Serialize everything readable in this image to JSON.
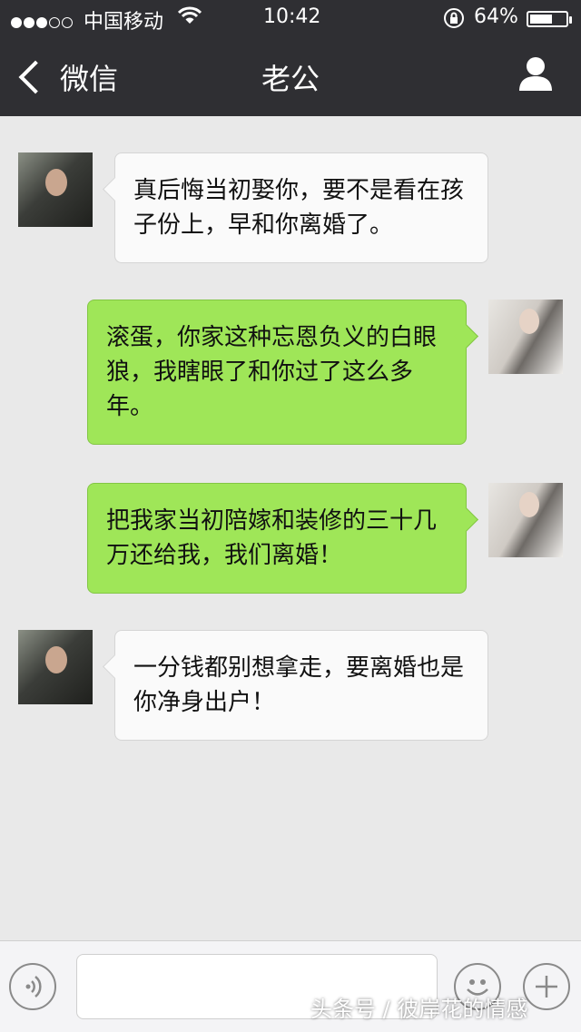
{
  "status_bar": {
    "carrier": "中国移动",
    "time": "10:42",
    "battery_percent": "64%",
    "battery_level": 0.64,
    "signal_bars_filled": 3,
    "signal_bars_total": 5
  },
  "nav": {
    "back_label": "微信",
    "title": "老公",
    "profile_icon": "person-icon"
  },
  "messages": [
    {
      "side": "in",
      "sender": "husband",
      "text": "真后悔当初娶你，要不是看在孩子份上，早和你离婚了。"
    },
    {
      "side": "out",
      "sender": "wife",
      "text": "滚蛋，你家这种忘恩负义的白眼狼，我瞎眼了和你过了这么多年。"
    },
    {
      "side": "out",
      "sender": "wife",
      "text": "把我家当初陪嫁和装修的三十几万还给我，我们离婚！"
    },
    {
      "side": "in",
      "sender": "husband",
      "text": "一分钱都别想拿走，要离婚也是你净身出户！"
    }
  ],
  "input_bar": {
    "voice_icon": "voice-icon",
    "emoji_icon": "emoji-icon",
    "plus_icon": "plus-icon",
    "input_value": ""
  },
  "watermark": "头条号 / 彼岸花的情感",
  "colors": {
    "header_bg": "#2f2f33",
    "chat_bg": "#e9e9e9",
    "outgoing_bubble": "#9fe658",
    "incoming_bubble": "#fafafa"
  }
}
